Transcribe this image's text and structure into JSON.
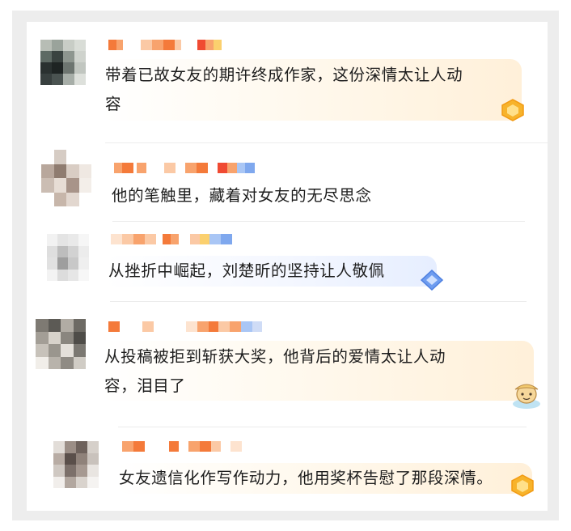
{
  "comments": [
    {
      "text": "带着已故女友的期许终成作家，这份深情太让人动\n容",
      "badge": "gold-gem-badge-icon"
    },
    {
      "text": "他的笔触里，藏着对女友的无尽思念",
      "badge": ""
    },
    {
      "text": "从挫折中崛起，刘楚昕的坚持让人敬佩",
      "badge": "blue-diamond-badge-icon"
    },
    {
      "text": "从投稿被拒到斩获大奖，他背后的爱情太让人动\n容，泪目了",
      "badge": "cartoon-mascot-badge-icon"
    },
    {
      "text": "女友遗信化作写作动力，他用奖杯告慰了那段深情。",
      "badge": "gold-gem-badge-icon"
    }
  ],
  "colors": {
    "nickname_pixels": [
      "#f47a3a",
      "#f8a36d",
      "#fbc9a5",
      "#fde3cf",
      "#f04a32",
      "#fbd06e",
      "#a9c6f5",
      "#7fa8ee"
    ],
    "gold_badge": "#f7b32b",
    "blue_badge": "#6d9cf0"
  }
}
